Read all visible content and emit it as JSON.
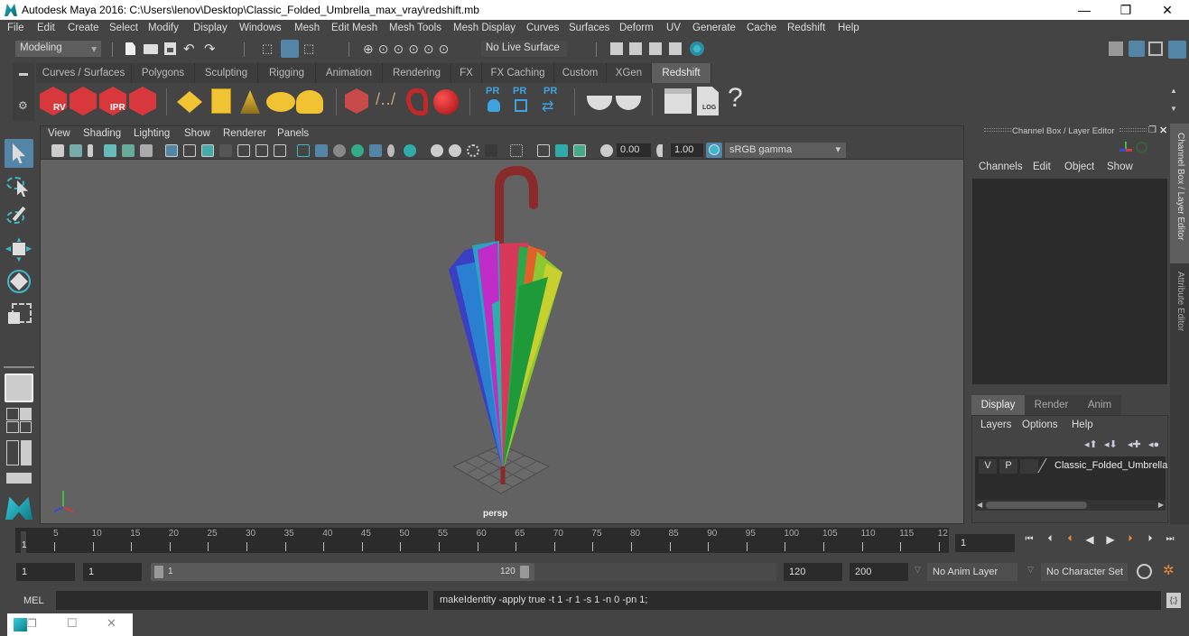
{
  "window": {
    "title": "Autodesk Maya 2016: C:\\Users\\lenov\\Desktop\\Classic_Folded_Umbrella_max_vray\\redshift.mb",
    "minimize_glyph": "—",
    "restore_glyph": "❐",
    "close_glyph": "✕"
  },
  "menubar": [
    "File",
    "Edit",
    "Create",
    "Select",
    "Modify",
    "Display",
    "Windows",
    "Mesh",
    "Edit Mesh",
    "Mesh Tools",
    "Mesh Display",
    "Curves",
    "Surfaces",
    "Deform",
    "UV",
    "Generate",
    "Cache",
    "Redshift",
    "Help"
  ],
  "status_line": {
    "mode": "Modeling",
    "live_surface": "No Live Surface"
  },
  "shelf": {
    "tabs": [
      "Curves / Surfaces",
      "Polygons",
      "Sculpting",
      "Rigging",
      "Animation",
      "Rendering",
      "FX",
      "FX Caching",
      "Custom",
      "XGen",
      "Redshift"
    ],
    "active_tab": "Redshift",
    "labels": {
      "rv": "RV",
      "ipr": "IPR",
      "pr": "PR",
      "log": "LOG",
      "help": "?"
    }
  },
  "viewport": {
    "menu": [
      "View",
      "Shading",
      "Lighting",
      "Show",
      "Renderer",
      "Panels"
    ],
    "exposure": "0.00",
    "gamma": "1.00",
    "color_space": "sRGB gamma",
    "camera_label": "persp",
    "colors": {
      "background": "#626262",
      "handle": "#8b2a2a"
    }
  },
  "channel_box": {
    "title": "Channel Box / Layer Editor",
    "menu": [
      "Channels",
      "Edit",
      "Object",
      "Show"
    ],
    "side_tabs": [
      "Channel Box / Layer Editor",
      "Attribute Editor"
    ]
  },
  "layer_editor": {
    "tabs": [
      "Display",
      "Render",
      "Anim"
    ],
    "active_tab": "Display",
    "menu": [
      "Layers",
      "Options",
      "Help"
    ],
    "layers": [
      {
        "v": "V",
        "p": "P",
        "name": "Classic_Folded_Umbrella"
      }
    ]
  },
  "timeline": {
    "ticks": [
      "5",
      "10",
      "15",
      "20",
      "25",
      "30",
      "35",
      "40",
      "45",
      "50",
      "55",
      "60",
      "65",
      "70",
      "75",
      "80",
      "85",
      "90",
      "95",
      "100",
      "105",
      "110",
      "115",
      "12"
    ],
    "current_marker": "1",
    "current_frame": "1"
  },
  "range": {
    "start": "1",
    "playback_start": "1",
    "slider_start": "1",
    "slider_end": "120",
    "playback_end": "120",
    "end": "200",
    "anim_layer": "No Anim Layer",
    "character_set": "No Character Set"
  },
  "command_line": {
    "language": "MEL",
    "input": "",
    "result": "makeIdentity -apply true -t 1 -r 1 -s 1 -n 0 -pn 1;"
  },
  "accent": {
    "blue": "#5285a6",
    "teal": "#3fb7c9",
    "orange": "#e58a3c",
    "redshift_red": "#d8383c",
    "yellow": "#f1c232"
  }
}
